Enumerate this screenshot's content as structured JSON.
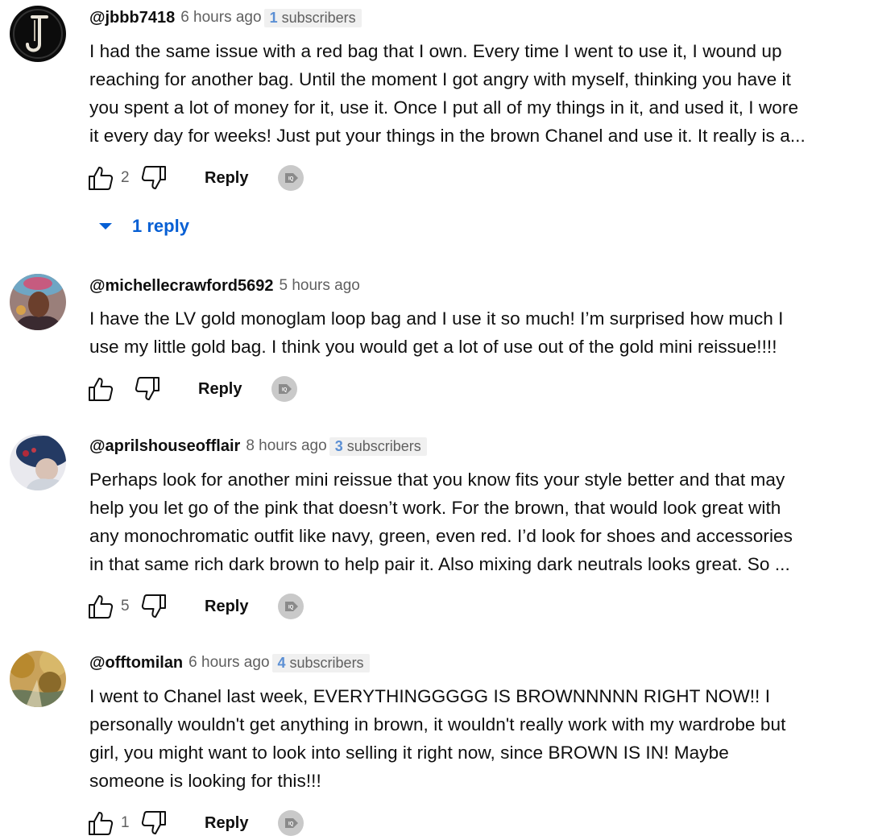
{
  "comments": [
    {
      "handle": "@jbbb7418",
      "time": "6 hours ago",
      "subs_count": "1",
      "subs_label": "subscribers",
      "lines": [
        "I had the same issue with a red bag that I own.  Every time I went to use it, I wound up",
        "reaching for another bag.  Until the moment I got angry with myself, thinking you have it",
        "you spent a lot of money for it, use it.  Once I put all of my things in it, and used it, I wore",
        "it every day for weeks! Just put your things in the brown Chanel and use it.  It really is a..."
      ],
      "likes": "2",
      "reply_label": "Reply",
      "replies_label": "1 reply",
      "avatar_icon": "letter-j-monogram"
    },
    {
      "handle": "@michellecrawford5692",
      "time": "5 hours ago",
      "lines": [
        "I have the LV gold monoglam loop bag and I use it so much! I’m surprised how much I",
        "use my little gold bag. I think you would get a lot of use out of the gold mini reissue!!!!"
      ],
      "likes": "",
      "reply_label": "Reply",
      "avatar_icon": "woman-portrait"
    },
    {
      "handle": "@aprilshouseofflair",
      "time": "8 hours ago",
      "subs_count": "3",
      "subs_label": "subscribers",
      "lines": [
        "Perhaps look for another mini reissue that you know fits your style better and that may",
        "help you let go of the pink that doesn’t work. For the brown, that would look great with",
        "any monochromatic outfit like navy, green, even red. I’d look for shoes and accessories",
        "in that same rich dark brown to help pair it. Also mixing dark neutrals looks great. So ..."
      ],
      "likes": "5",
      "reply_label": "Reply",
      "avatar_icon": "navy-hat-portrait"
    },
    {
      "handle": "@offtomilan",
      "time": "6 hours ago",
      "subs_count": "4",
      "subs_label": "subscribers",
      "lines": [
        "I went to Chanel last week, EVERYTHINGGGGG IS BROWNNNNN RIGHT NOW!! I",
        "personally wouldn't get anything in brown, it wouldn't really work with my wardrobe but",
        "girl, you might want to look into selling it right now, since BROWN IS IN! Maybe",
        "someone is looking for this!!!"
      ],
      "likes": "1",
      "reply_label": "Reply",
      "avatar_icon": "autumn-landscape"
    }
  ],
  "colors": {
    "link_blue": "#065fd4",
    "subs_blue": "#5b8fd4",
    "muted": "#606060"
  },
  "icons": {
    "like": "thumbs-up-icon",
    "dislike": "thumbs-down-icon",
    "extension": "tag-icon",
    "expand": "caret-down-icon"
  }
}
